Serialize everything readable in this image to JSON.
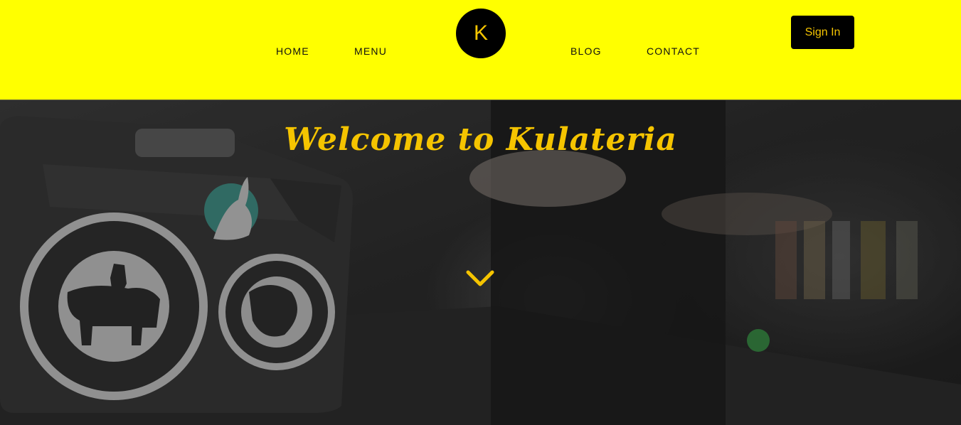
{
  "nav": {
    "home": "HOME",
    "menu": "MENU",
    "blog": "BLOG",
    "contact": "CONTACT",
    "logo_letter": "K",
    "signin": "Sign In"
  },
  "hero": {
    "title": "Welcome to Kulateria",
    "scroll_icon": "chevron-down-icon"
  },
  "colors": {
    "header_bg": "#ffff00",
    "accent": "#f5c400",
    "dark": "#000000"
  }
}
